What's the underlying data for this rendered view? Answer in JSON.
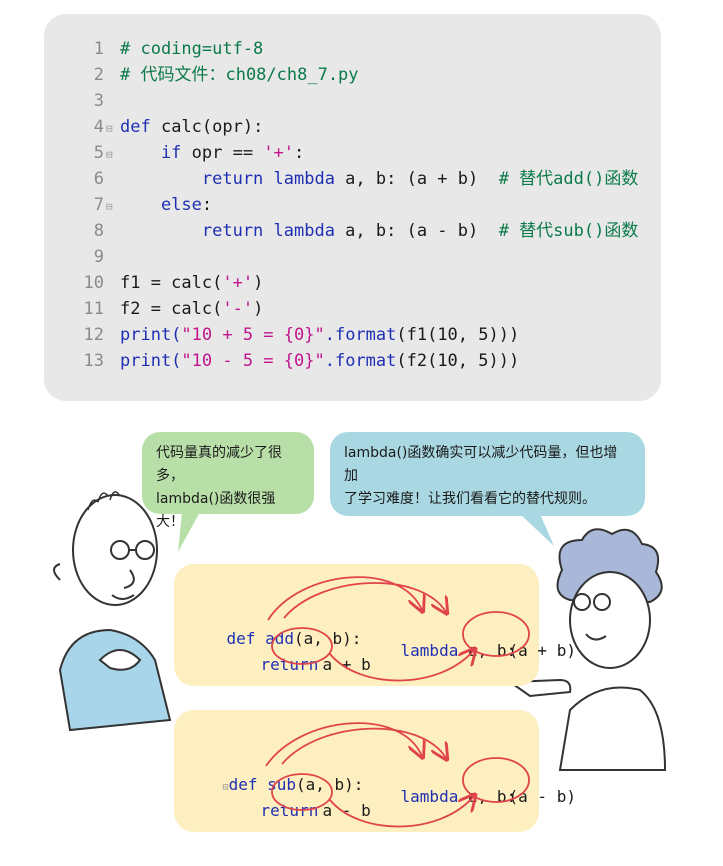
{
  "code": {
    "lines": [
      {
        "n": "1",
        "fold": "",
        "html_parts": [
          {
            "t": "# coding=utf-8",
            "c": "cm"
          }
        ]
      },
      {
        "n": "2",
        "fold": "",
        "html_parts": [
          {
            "t": "# 代码文件：ch08/ch8_7.py",
            "c": "cm"
          }
        ]
      },
      {
        "n": "3",
        "fold": "",
        "html_parts": []
      },
      {
        "n": "4",
        "fold": "⊟",
        "html_parts": [
          {
            "t": "def ",
            "c": "kw"
          },
          {
            "t": "calc(opr):",
            "c": ""
          }
        ]
      },
      {
        "n": "5",
        "fold": "⊟",
        "html_parts": [
          {
            "t": "    if ",
            "c": "kw"
          },
          {
            "t": "opr == ",
            "c": ""
          },
          {
            "t": "'+'",
            "c": "str"
          },
          {
            "t": ":",
            "c": ""
          }
        ]
      },
      {
        "n": "6",
        "fold": "",
        "html_parts": [
          {
            "t": "        return lambda ",
            "c": "kw"
          },
          {
            "t": "a, b: (a + b)  ",
            "c": ""
          },
          {
            "t": "# 替代add()函数",
            "c": "cm"
          }
        ]
      },
      {
        "n": "7",
        "fold": "⊟",
        "html_parts": [
          {
            "t": "    else",
            "c": "kw"
          },
          {
            "t": ":",
            "c": ""
          }
        ]
      },
      {
        "n": "8",
        "fold": "",
        "html_parts": [
          {
            "t": "        return lambda ",
            "c": "kw"
          },
          {
            "t": "a, b: (a - b)  ",
            "c": ""
          },
          {
            "t": "# 替代sub()函数",
            "c": "cm"
          }
        ]
      },
      {
        "n": "9",
        "fold": "",
        "html_parts": []
      },
      {
        "n": "10",
        "fold": "",
        "html_parts": [
          {
            "t": "f1 = calc(",
            "c": ""
          },
          {
            "t": "'+'",
            "c": "str"
          },
          {
            "t": ")",
            "c": ""
          }
        ]
      },
      {
        "n": "11",
        "fold": "",
        "html_parts": [
          {
            "t": "f2 = calc(",
            "c": ""
          },
          {
            "t": "'-'",
            "c": "str"
          },
          {
            "t": ")",
            "c": ""
          }
        ]
      },
      {
        "n": "12",
        "fold": "",
        "html_parts": [
          {
            "t": "print(",
            "c": "kw"
          },
          {
            "t": "\"10 + 5 = {0}\"",
            "c": "str"
          },
          {
            "t": ".format",
            "c": "kw"
          },
          {
            "t": "(f1(10, 5)))",
            "c": ""
          }
        ]
      },
      {
        "n": "13",
        "fold": "",
        "html_parts": [
          {
            "t": "print(",
            "c": "kw"
          },
          {
            "t": "\"10 - 5 = {0}\"",
            "c": "str"
          },
          {
            "t": ".format",
            "c": "kw"
          },
          {
            "t": "(f2(10, 5)))",
            "c": ""
          }
        ]
      }
    ]
  },
  "bubbles": {
    "left": {
      "line1": "代码量真的减少了很多，",
      "line2": "lambda()函数很强大！"
    },
    "right": {
      "line1": "lambda()函数确实可以减少代码量，但也增加",
      "line2": "了学习难度！让我们看看它的替代规则。"
    }
  },
  "diagram_add": {
    "def_kw": "def ",
    "def_name": "add",
    "def_args": "(a, b):",
    "ret_kw": "return",
    "ret_expr": "a + b",
    "lam_kw": "lambda",
    "lam_args": " a, b: ",
    "lam_expr": "(a + b)"
  },
  "diagram_sub": {
    "fold": "⊟",
    "def_kw": "def ",
    "def_name": "sub",
    "def_args": "(a, b):",
    "ret_kw": "return",
    "ret_expr": "a - b",
    "lam_kw": "lambda",
    "lam_args": " a, b: ",
    "lam_expr": "(a - b)"
  },
  "colors": {
    "arrow": "#e0444a",
    "keyword": "#1f2fb3",
    "comment": "#0b7a4a",
    "string": "#c0158e"
  }
}
